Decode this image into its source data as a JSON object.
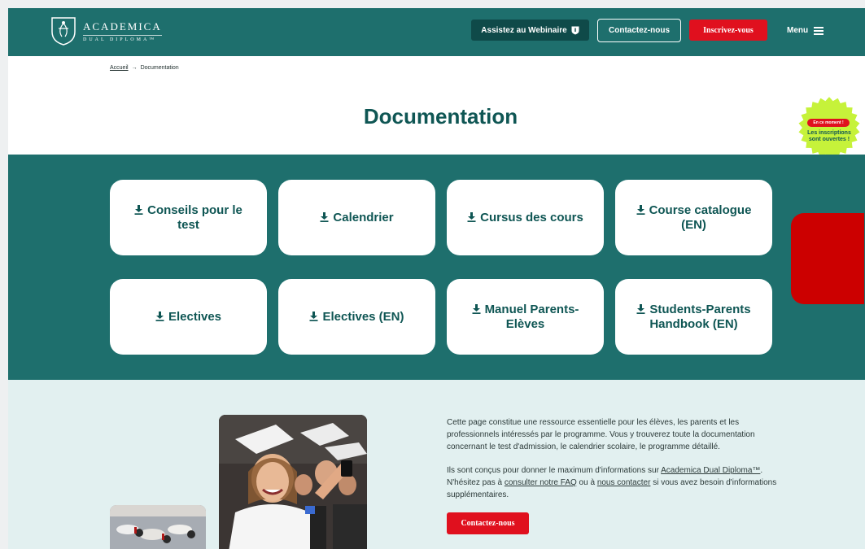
{
  "header": {
    "brand_name": "ACADEMICA",
    "brand_sub": "DUAL DIPLOMA™",
    "webinar_label": "Assistez au Webinaire",
    "contact_label": "Contactez-nous",
    "signup_label": "Inscrivez-vous",
    "menu_label": "Menu"
  },
  "breadcrumb": {
    "home": "Accueil",
    "separator": "→",
    "current": "Documentation"
  },
  "page_title": "Documentation",
  "badge": {
    "pill": "En ce moment !",
    "text": "Les inscriptions sont ouvertes !"
  },
  "docs": [
    {
      "label": "Conseils pour le test"
    },
    {
      "label": "Calendrier"
    },
    {
      "label": "Cursus des cours"
    },
    {
      "label": "Course catalogue (EN)"
    },
    {
      "label": "Electives"
    },
    {
      "label": "Electives (EN)"
    },
    {
      "label": "Manuel Parents-Elèves"
    },
    {
      "label": "Students-Parents Handbook (EN)"
    }
  ],
  "intro": {
    "p1": "Cette page constitue une ressource essentielle pour les élèves, les parents et les professionnels intéressés par le programme. Vous y trouverez toute la documentation concernant le test d'admission, le calendrier scolaire, le programme détaillé.",
    "p2_a": "Ils sont conçus pour donner le maximum d'informations sur ",
    "p2_link1": "Academica Dual Diploma™",
    "p2_b": ". N'hésitez pas à ",
    "p2_link2": "consulter notre FAQ",
    "p2_c": " ou à ",
    "p2_link3": "nous contacter",
    "p2_d": " si vous avez besoin d'informations supplémentaires."
  },
  "cta_label": "Contactez-nous",
  "colors": {
    "teal": "#1e6f6d",
    "dark_teal": "#0f4a49",
    "red": "#e0101e",
    "light_bg": "#e2f0f0",
    "badge_green": "#c6f23a"
  }
}
